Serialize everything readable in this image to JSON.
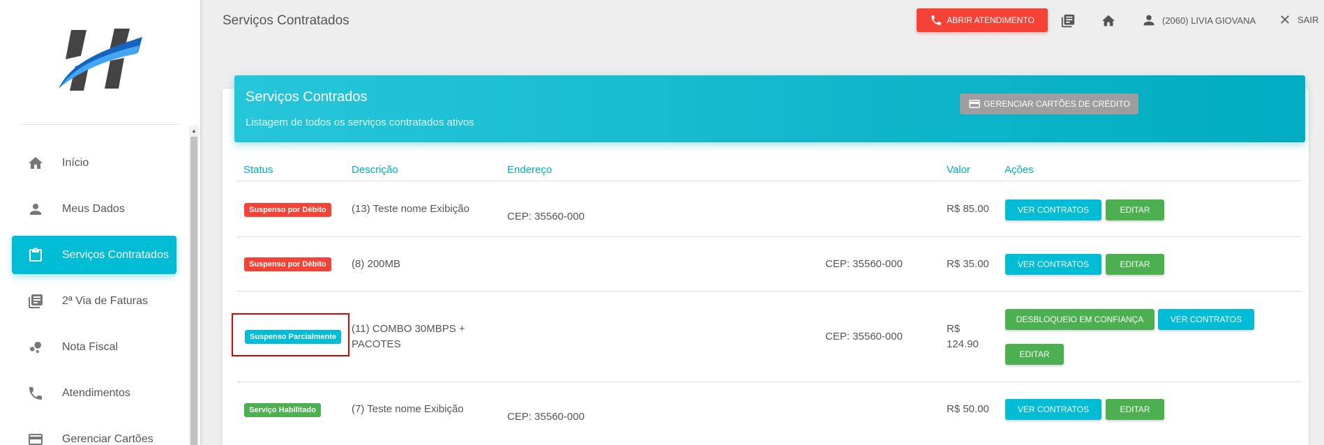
{
  "colors": {
    "accent": "#00bcd4",
    "danger": "#f44336",
    "success": "#4caf50",
    "neutral": "#9e9e9e"
  },
  "sidebar": {
    "items": [
      {
        "label": "Início",
        "icon": "home-icon"
      },
      {
        "label": "Meus Dados",
        "icon": "person-icon"
      },
      {
        "label": "Serviços Contratados",
        "icon": "clipboard-icon",
        "active": true
      },
      {
        "label": "2ª Via de Faturas",
        "icon": "library-books-icon"
      },
      {
        "label": "Nota Fiscal",
        "icon": "bubble-chart-icon"
      },
      {
        "label": "Atendimentos",
        "icon": "phone-icon"
      },
      {
        "label": "Gerenciar Cartões",
        "icon": "credit-card-icon"
      }
    ]
  },
  "header": {
    "title": "Serviços Contratados",
    "open_ticket_label": "ABRIR ATENDIMENTO",
    "user_label": "(2060) LIVIA GIOVANA",
    "logout_label": "SAIR"
  },
  "card": {
    "title": "Serviços Contrados",
    "subtitle": "Listagem de todos os serviços contratados ativos",
    "manage_cards_label": "GERENCIAR CARTÕES DE CRÉDITO"
  },
  "table": {
    "headers": {
      "status": "Status",
      "descricao": "Descrição",
      "endereco": "Endereço",
      "valor": "Valor",
      "acoes": "Ações"
    },
    "rows": [
      {
        "status": "Suspenso por Débito",
        "descricao": "(13) Teste nome Exibição",
        "endereco": "CEP: 35560-000",
        "valor": "R$ 85.00",
        "btn_contratos": "VER CONTRATOS",
        "btn_editar": "EDITAR"
      },
      {
        "status": "Suspenso por Débito",
        "descricao": "(8) 200MB",
        "endereco": "CEP: 35560-000",
        "valor": "R$ 35.00",
        "btn_contratos": "VER CONTRATOS",
        "btn_editar": "EDITAR"
      },
      {
        "status": "Suspenso Parcialmente",
        "descricao_1": "(11) COMBO 30MBPS +",
        "descricao_2": "PACOTES",
        "endereco": "CEP: 35560-000",
        "valor_1": "R$",
        "valor_2": "124.90",
        "btn_desbloqueio": "DESBLOQUEIO EM CONFIANÇA",
        "btn_contratos": "VER CONTRATOS",
        "btn_editar": "EDITAR"
      },
      {
        "status": "Serviço Habilitado",
        "descricao": "(7) Teste nome Exibição",
        "endereco": "CEP: 35560-000",
        "valor": "R$ 50.00",
        "btn_contratos": "VER CONTRATOS",
        "btn_editar": "EDITAR"
      }
    ]
  }
}
